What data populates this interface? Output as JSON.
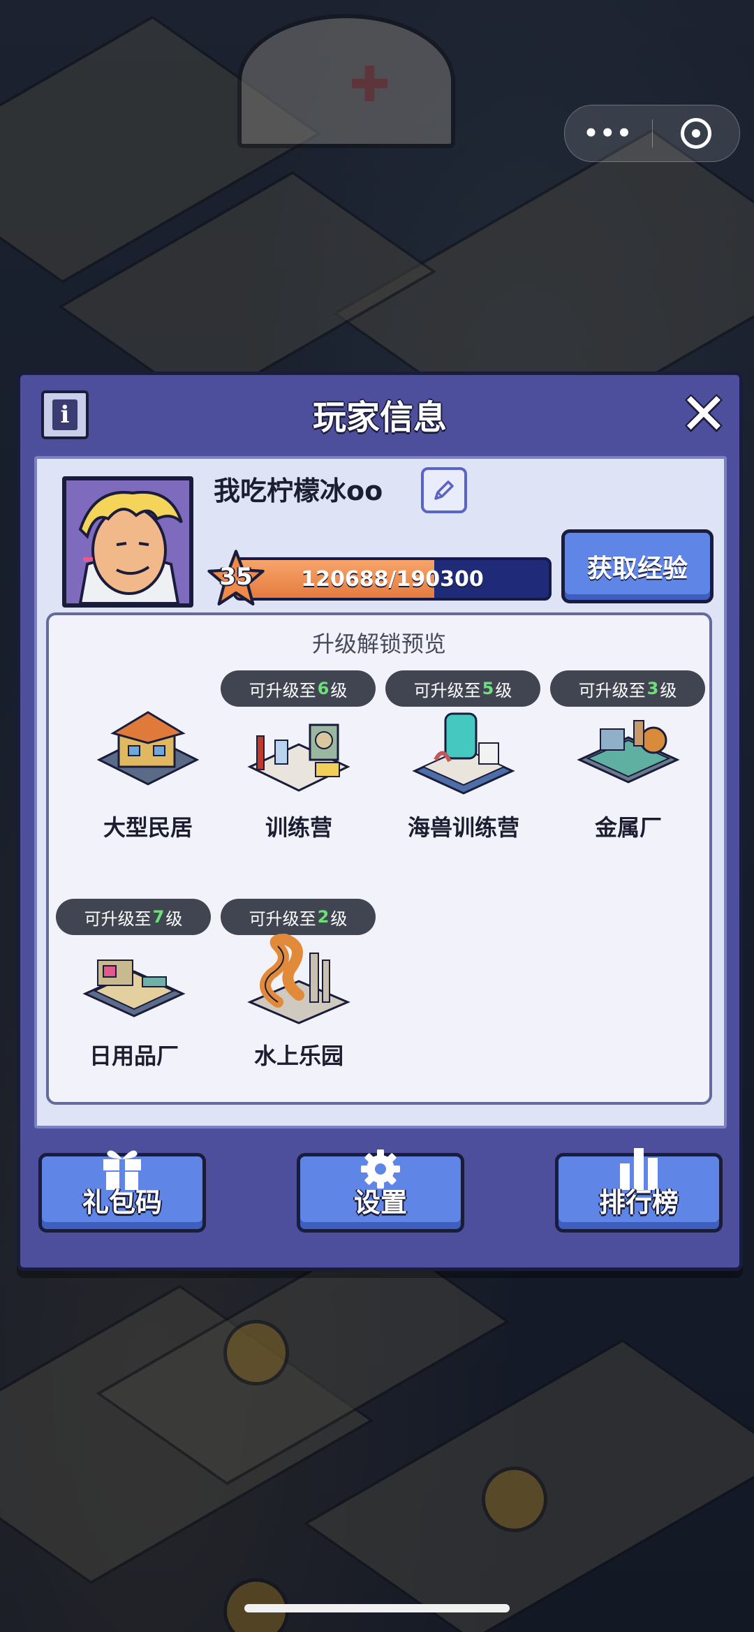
{
  "window": {
    "title": "玩家信息"
  },
  "capsule": {
    "more_icon": "more-dots-icon",
    "close_icon": "target-icon"
  },
  "player": {
    "name": "我吃柠檬冰oo",
    "level": "35",
    "xp_text": "120688/190300",
    "xp_progress": 0.634
  },
  "gain_xp_label": "获取经验",
  "preview": {
    "title": "升级解锁预览",
    "buildings": [
      {
        "name": "大型民居",
        "has_tag": false,
        "tag_prefix": "",
        "tag_level": "",
        "tag_suffix": ""
      },
      {
        "name": "训练营",
        "has_tag": true,
        "tag_prefix": "可升级至",
        "tag_level": "6",
        "tag_suffix": "级"
      },
      {
        "name": "海兽训练营",
        "has_tag": true,
        "tag_prefix": "可升级至",
        "tag_level": "5",
        "tag_suffix": "级"
      },
      {
        "name": "金属厂",
        "has_tag": true,
        "tag_prefix": "可升级至",
        "tag_level": "3",
        "tag_suffix": "级"
      },
      {
        "name": "日用品厂",
        "has_tag": true,
        "tag_prefix": "可升级至",
        "tag_level": "7",
        "tag_suffix": "级"
      },
      {
        "name": "水上乐园",
        "has_tag": true,
        "tag_prefix": "可升级至",
        "tag_level": "2",
        "tag_suffix": "级"
      }
    ]
  },
  "buttons": {
    "gift_code": "礼包码",
    "settings": "设置",
    "leaderboard": "排行榜"
  },
  "colors": {
    "panel": "#4e4f9c",
    "button": "#5f86e6",
    "xp_fill": "#e57b3f",
    "level_highlight": "#6ee07a"
  }
}
